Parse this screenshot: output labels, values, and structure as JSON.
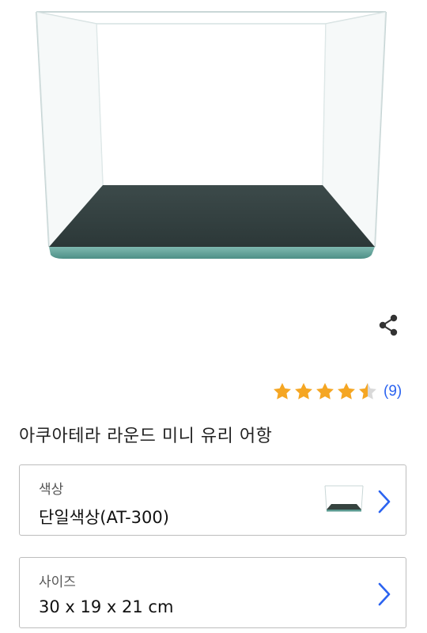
{
  "product": {
    "title": "아쿠아테라 라운드 미니 유리 어항",
    "rating": {
      "value": 4.5,
      "max": 5,
      "count_label": "(9)"
    }
  },
  "options": [
    {
      "label": "색상",
      "value": "단일색상(AT-300)",
      "has_thumbnail": true
    },
    {
      "label": "사이즈",
      "value": "30 x 19 x 21 cm",
      "has_thumbnail": false
    }
  ],
  "icons": {
    "share": "share-icon",
    "star": "star-icon",
    "chevron": "chevron-right-icon"
  },
  "colors": {
    "star": "#f5a623",
    "star_empty": "#d9d9d9",
    "link": "#2b63f0",
    "chevron": "#2b63f0",
    "border": "#bdbdbd"
  }
}
